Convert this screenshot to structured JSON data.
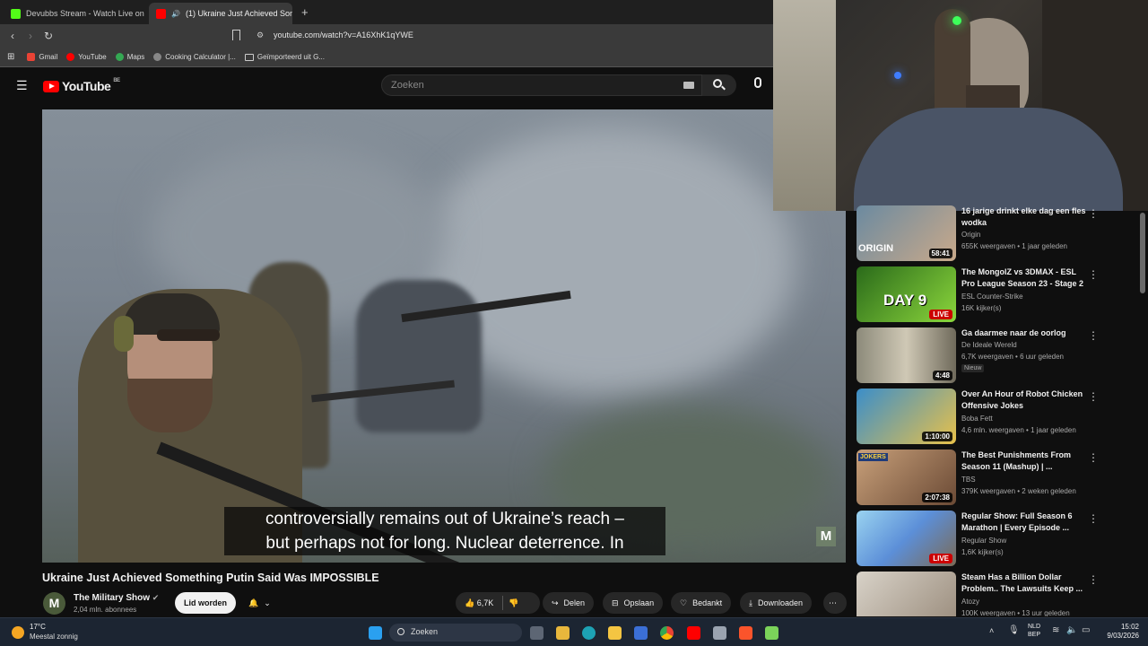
{
  "browser": {
    "tabs": [
      {
        "label": "Devubbs Stream - Watch Live on"
      },
      {
        "label": "(1) Ukraine Just Achieved Som"
      }
    ],
    "url": "youtube.com/watch?v=A16XhK1qYWE",
    "bookmarks": [
      "Gmail",
      "YouTube",
      "Maps",
      "Cooking Calculator |...",
      "Geïmporteerd uit G..."
    ]
  },
  "youtube": {
    "logo_text": "YouTube",
    "logo_region": "BE",
    "search_placeholder": "Zoeken"
  },
  "video": {
    "subtitle_line1": "controversially remains out of Ukraine’s reach –",
    "subtitle_line2": "but perhaps not for long. Nuclear deterrence. In",
    "watermark": "M",
    "title": "Ukraine Just Achieved Something Putin Said Was IMPOSSIBLE",
    "channel": "The Military Show",
    "channel_initial": "M",
    "subscribers": "2,04 mln. abonnees",
    "join_label": "Lid worden",
    "likes": "6,7K",
    "share_label": "Delen",
    "save_label": "Opslaan",
    "thanks_label": "Bedankt",
    "download_label": "Downloaden"
  },
  "sidebar": [
    {
      "title": "16 jarige drinkt elke dag een fles wodka",
      "channel": "Origin",
      "meta": "655K weergaven • 1 jaar geleden",
      "duration": "58:41",
      "thumb_text": "ORIGIN"
    },
    {
      "title": "The MongolZ vs 3DMAX - ESL Pro League Season 23 - Stage 2",
      "channel": "ESL Counter-Strike",
      "meta": "16K kijker(s)",
      "live": "LIVE",
      "thumb_text": "DAY 9"
    },
    {
      "title": "Ga daarmee naar de oorlog",
      "channel": "De Ideale Wereld",
      "meta": "6,7K weergaven • 6 uur geleden",
      "badge": "Nieuw",
      "duration": "4:48"
    },
    {
      "title": "Over An Hour of Robot Chicken Offensive Jokes",
      "channel": "Boba Fett",
      "meta": "4,6 mln. weergaven • 1 jaar geleden",
      "duration": "1:10:00"
    },
    {
      "title": "The Best Punishments From Season 11 (Mashup) | ...",
      "channel": "TBS",
      "meta": "379K weergaven • 2 weken geleden",
      "duration": "2:07:38",
      "thumb_text": "JOKERS"
    },
    {
      "title": "Regular Show: Full Season 6 Marathon | Every Episode ...",
      "channel": "Regular Show",
      "meta": "1,6K kijker(s)",
      "live": "LIVE"
    },
    {
      "title": "Steam Has a Billion Dollar Problem.. The Lawsuits Keep ...",
      "channel": "Atozy",
      "meta": "100K weergaven • 13 uur geleden"
    }
  ],
  "taskbar": {
    "weather_temp": "17°C",
    "weather_desc": "Meestal zonnig",
    "search_label": "Zoeken",
    "lang_top": "NLD",
    "lang_bottom": "BEP",
    "time": "15:02",
    "date": "9/03/2026"
  }
}
